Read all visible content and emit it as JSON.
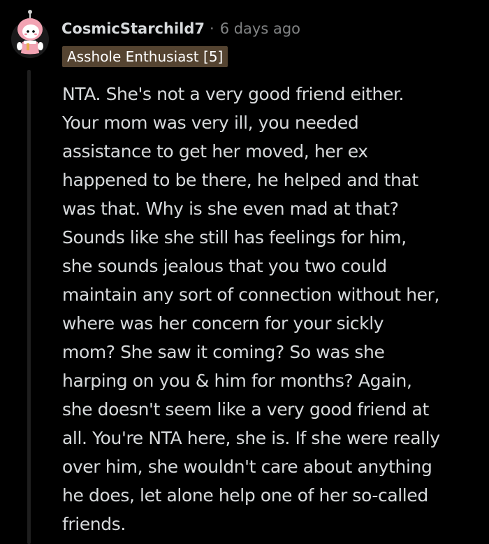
{
  "comment": {
    "author": "CosmicStarchild7",
    "separator": "·",
    "timestamp": "6 days ago",
    "flair": "Asshole Enthusiast [5]",
    "avatar_icon": "snoo-avatar-icon",
    "body_lines": [
      "NTA. She's not a very good friend either.",
      "Your mom was very ill, you needed",
      "assistance to get her moved, her ex",
      "happened to be there, he helped and that",
      "was that. Why is she even mad at that?",
      "Sounds like she still has feelings for him,",
      "she sounds jealous that you two could",
      "maintain any sort of connection without her,",
      "where was her concern for your sickly",
      "mom? She saw it coming? So was she",
      "harping on you & him for months? Again,",
      "she doesn't seem like a very good friend at",
      "all. You're NTA here, she is. If she were really",
      "over him, she wouldn't care about anything",
      "he does, let alone help one of her so-called",
      "friends."
    ]
  },
  "colors": {
    "background": "#000000",
    "text": "#d7dadc",
    "meta": "#818384",
    "flair_bg": "#554431",
    "thread_line": "#1e1e1e",
    "avatar_pink": "#f2a3b3"
  }
}
